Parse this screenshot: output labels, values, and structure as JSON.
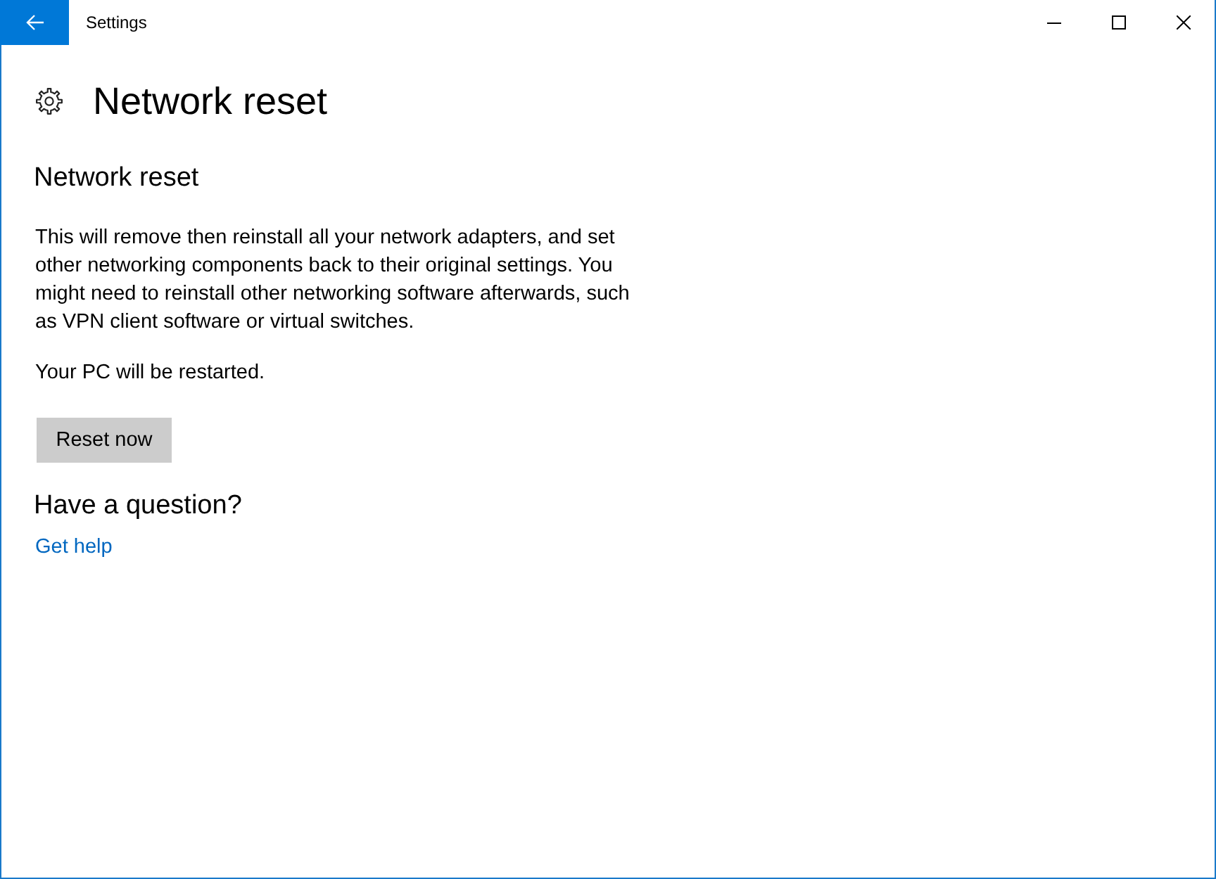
{
  "window": {
    "title": "Settings"
  },
  "page": {
    "title": "Network reset"
  },
  "section": {
    "heading": "Network reset",
    "paragraphs": [
      "This will remove then reinstall all your network adapters, and set other networking components back to their original settings. You might need to reinstall other networking software afterwards, such as VPN client software or virtual switches.",
      "Your PC will be restarted."
    ],
    "button": "Reset now"
  },
  "help": {
    "heading": "Have a question?",
    "link": "Get help"
  }
}
